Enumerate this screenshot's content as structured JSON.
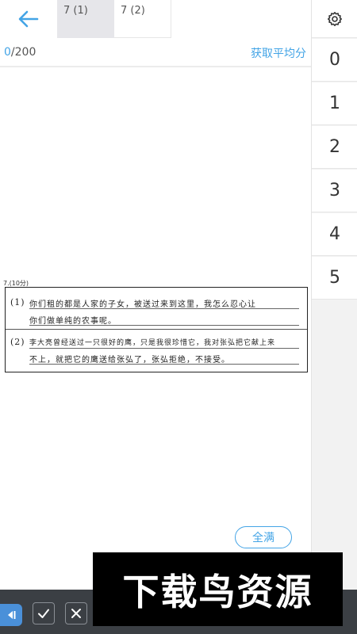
{
  "tabs": [
    {
      "label": "7 (1)",
      "active": true
    },
    {
      "label": "7 (2)",
      "active": false
    }
  ],
  "score": {
    "current": "0",
    "total": "/200"
  },
  "avg_link": "获取平均分",
  "score_options": [
    "0",
    "1",
    "2",
    "3",
    "4",
    "5"
  ],
  "sheet": {
    "question_label": "7.(10分)",
    "part1_label": "(1)",
    "part1_line1": "你们租的都是人家的子女，被送过来到这里，我怎么忍心让",
    "part1_line2": "你们做单纯的农事呢。",
    "part2_label": "(2)",
    "part2_line1": "李大亮曾经送过一只很好的鹰，只是我很珍惜它，我对张弘把它献上来",
    "part2_line2": "不上，就把它的鹰送给张弘了，张弘拒绝，不接受。"
  },
  "full_marks_button": "全满",
  "watermark_text": "下载鸟资源",
  "colors": {
    "accent": "#43a4e6",
    "bottom_bar": "#3b3f44"
  }
}
